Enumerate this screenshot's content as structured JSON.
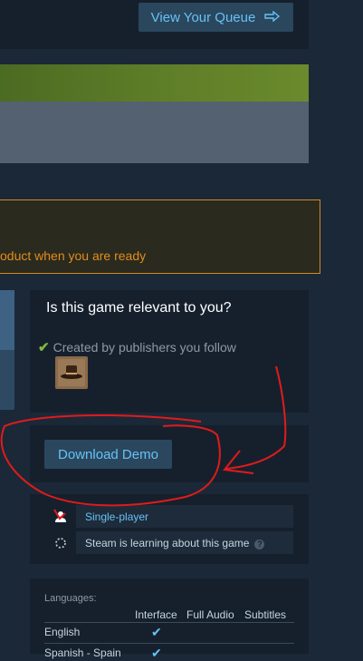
{
  "queue": {
    "button_label": "View Your Queue",
    "icon": "arrow-right-icon"
  },
  "notice": {
    "text": "oduct when you are ready"
  },
  "relevance": {
    "title": "Is this game relevant to you?",
    "reason": "Created by publishers you follow",
    "check_icon": "check-icon"
  },
  "demo": {
    "button_label": "Download Demo"
  },
  "features": [
    {
      "label": "Single-player",
      "icon": "single-player-icon"
    },
    {
      "label": "Steam is learning about this game",
      "icon": "loading-icon",
      "help_icon": "question-icon"
    }
  ],
  "languages": {
    "title": "Languages:",
    "headers": [
      "Interface",
      "Full Audio",
      "Subtitles"
    ],
    "rows": [
      {
        "name": "English",
        "interface": "✔",
        "full_audio": "",
        "subtitles": ""
      },
      {
        "name": "Spanish - Spain",
        "interface": "✔",
        "full_audio": "",
        "subtitles": ""
      }
    ]
  },
  "colors": {
    "accent": "#67c1f5",
    "notice": "#e38d1c",
    "annotation": "#e01b1b"
  }
}
